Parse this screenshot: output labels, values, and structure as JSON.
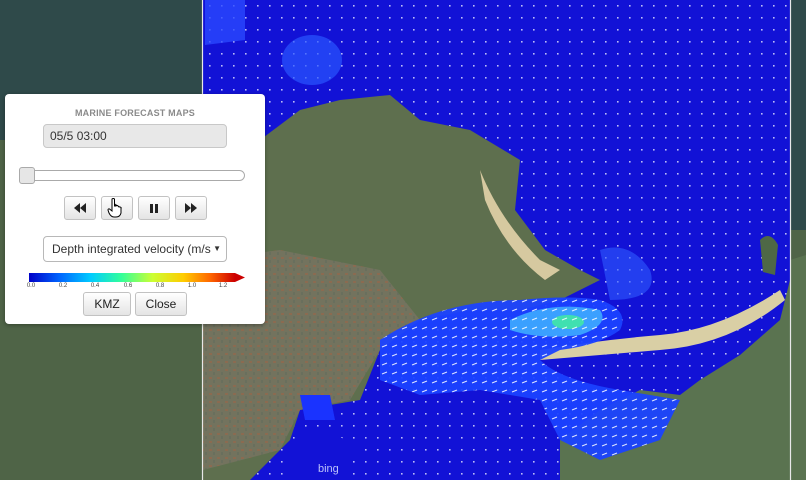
{
  "panel": {
    "title": "MARINE FORECAST MAPS",
    "datetime": "05/5 03:00",
    "time_slider": {
      "position": 0.0
    },
    "controls": {
      "rewind_icon": "fast-backward-icon",
      "play_icon": "play-icon",
      "pause_icon": "pause-icon",
      "forward_icon": "fast-forward-icon"
    },
    "variable_select": {
      "selected": "Depth integrated velocity (m/s"
    },
    "colorbar": {
      "ticks": [
        "0.0",
        "0.2",
        "0.4",
        "0.6",
        "0.8",
        "1.0",
        "1.2"
      ],
      "colors": [
        "#0000c8",
        "#0066ff",
        "#00ccff",
        "#33ff99",
        "#ccff33",
        "#ffcc00",
        "#ff6600",
        "#cc0000"
      ]
    },
    "kmz_label": "KMZ",
    "close_label": "Close"
  },
  "map": {
    "attribution": "bing",
    "sea_color": "#1414d9",
    "current_color": "#2a8cff",
    "strong_current_color": "#33e6b0",
    "land_color": "#5f7350"
  }
}
